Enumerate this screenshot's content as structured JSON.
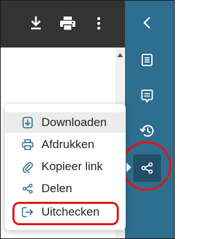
{
  "toolbar": {
    "icons": [
      "download-icon",
      "print-icon",
      "more-vertical-icon"
    ]
  },
  "sidebar": {
    "icons": [
      "chevron-left-icon",
      "document-list-icon",
      "comment-icon",
      "history-icon",
      "share-icon"
    ],
    "active": "share"
  },
  "menu": {
    "items": [
      {
        "label": "Downloaden",
        "icon": "download-file-icon",
        "highlighted": true
      },
      {
        "label": "Afdrukken",
        "icon": "print-icon",
        "highlighted": false
      },
      {
        "label": "Kopieer link",
        "icon": "paperclip-icon",
        "highlighted": false
      },
      {
        "label": "Delen",
        "icon": "share-icon",
        "highlighted": false
      },
      {
        "label": "Uitchecken",
        "icon": "checkout-icon",
        "highlighted": false
      }
    ]
  },
  "colors": {
    "toolbar_bg": "#333333",
    "sidebar_bg": "#2e6e8e",
    "sidebar_active_bg": "#214f67",
    "annotation_red": "#e0161b",
    "menu_highlight": "#ececec"
  }
}
